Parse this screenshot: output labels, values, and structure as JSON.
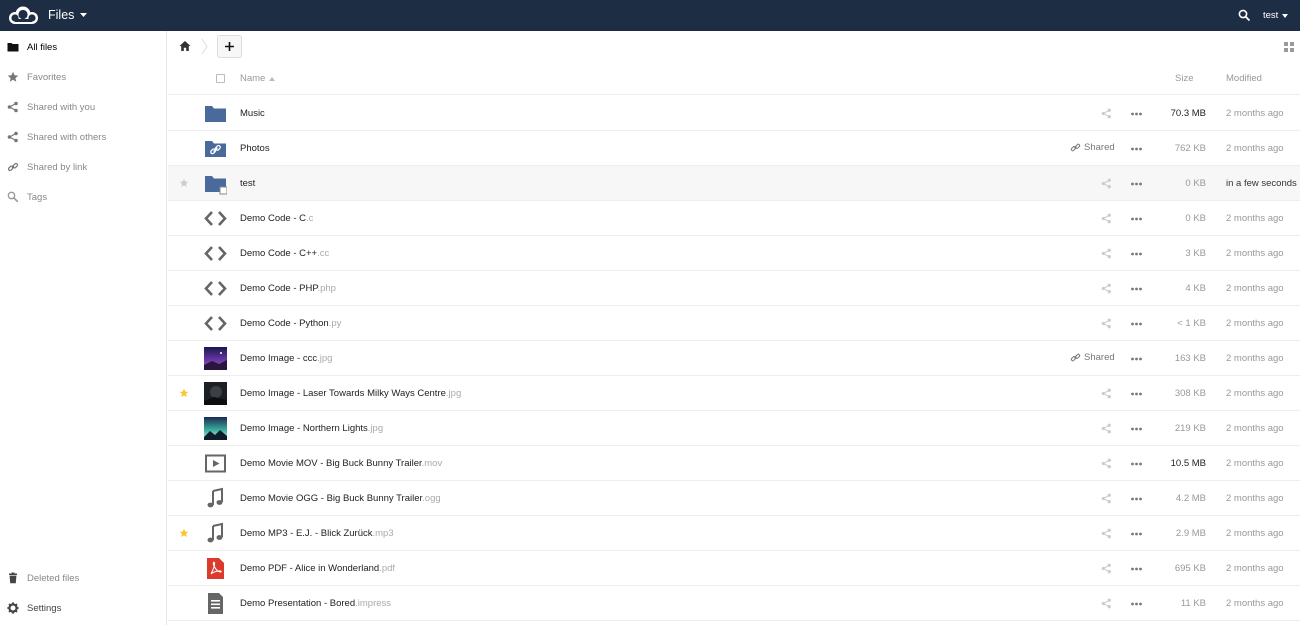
{
  "header": {
    "app_name": "Files",
    "user": "test"
  },
  "sidebar": {
    "items": [
      {
        "label": "All files",
        "icon": "folder-icon",
        "active": true
      },
      {
        "label": "Favorites",
        "icon": "star-icon",
        "active": false
      },
      {
        "label": "Shared with you",
        "icon": "share-icon",
        "active": false
      },
      {
        "label": "Shared with others",
        "icon": "share-icon",
        "active": false
      },
      {
        "label": "Shared by link",
        "icon": "link-icon",
        "active": false
      },
      {
        "label": "Tags",
        "icon": "tag-search-icon",
        "active": false
      }
    ],
    "footer": [
      {
        "label": "Deleted files",
        "icon": "trash-icon"
      },
      {
        "label": "Settings",
        "icon": "gear-icon"
      }
    ]
  },
  "table": {
    "headers": {
      "name": "Name",
      "size": "Size",
      "modified": "Modified"
    },
    "rows": [
      {
        "name": "Music",
        "ext": "",
        "type": "folder",
        "shared": "",
        "size": "70.3 MB",
        "size_big": true,
        "modified": "2 months ago",
        "favorite": false
      },
      {
        "name": "Photos",
        "ext": "",
        "type": "folder-link",
        "shared": "Shared",
        "size": "762 KB",
        "size_big": false,
        "modified": "2 months ago",
        "favorite": false
      },
      {
        "name": "test",
        "ext": "",
        "type": "folder-new",
        "shared": "",
        "size": "0 KB",
        "size_big": false,
        "modified": "in a few seconds",
        "favorite": false,
        "highlight": true
      },
      {
        "name": "Demo Code - C",
        "ext": ".c",
        "type": "code",
        "shared": "",
        "size": "0 KB",
        "size_big": false,
        "modified": "2 months ago",
        "favorite": false
      },
      {
        "name": "Demo Code - C++",
        "ext": ".cc",
        "type": "code",
        "shared": "",
        "size": "3 KB",
        "size_big": false,
        "modified": "2 months ago",
        "favorite": false
      },
      {
        "name": "Demo Code - PHP",
        "ext": ".php",
        "type": "code",
        "shared": "",
        "size": "4 KB",
        "size_big": false,
        "modified": "2 months ago",
        "favorite": false
      },
      {
        "name": "Demo Code - Python",
        "ext": ".py",
        "type": "code",
        "shared": "",
        "size": "< 1 KB",
        "size_big": false,
        "modified": "2 months ago",
        "favorite": false
      },
      {
        "name": "Demo Image - ccc",
        "ext": ".jpg",
        "type": "image-purple",
        "shared": "Shared",
        "size": "163 KB",
        "size_big": false,
        "modified": "2 months ago",
        "favorite": false
      },
      {
        "name": "Demo Image - Laser Towards Milky Ways Centre",
        "ext": ".jpg",
        "type": "image-dark",
        "shared": "",
        "size": "308 KB",
        "size_big": false,
        "modified": "2 months ago",
        "favorite": true
      },
      {
        "name": "Demo Image - Northern Lights",
        "ext": ".jpg",
        "type": "image-aurora",
        "shared": "",
        "size": "219 KB",
        "size_big": false,
        "modified": "2 months ago",
        "favorite": false
      },
      {
        "name": "Demo Movie MOV - Big Buck Bunny Trailer",
        "ext": ".mov",
        "type": "video",
        "shared": "",
        "size": "10.5 MB",
        "size_big": true,
        "modified": "2 months ago",
        "favorite": false
      },
      {
        "name": "Demo Movie OGG - Big Buck Bunny Trailer",
        "ext": ".ogg",
        "type": "audio",
        "shared": "",
        "size": "4.2 MB",
        "size_big": false,
        "modified": "2 months ago",
        "favorite": false
      },
      {
        "name": "Demo MP3 - E.J. - Blick Zurück",
        "ext": ".mp3",
        "type": "audio",
        "shared": "",
        "size": "2.9 MB",
        "size_big": false,
        "modified": "2 months ago",
        "favorite": true
      },
      {
        "name": "Demo PDF - Alice in Wonderland",
        "ext": ".pdf",
        "type": "pdf",
        "shared": "",
        "size": "695 KB",
        "size_big": false,
        "modified": "2 months ago",
        "favorite": false
      },
      {
        "name": "Demo Presentation - Bored",
        "ext": ".impress",
        "type": "document",
        "shared": "",
        "size": "11 KB",
        "size_big": false,
        "modified": "2 months ago",
        "favorite": false
      }
    ]
  },
  "colors": {
    "header_bg": "#1d2d44",
    "folder": "#4a6a9c",
    "favorite_star": "#fbc52d",
    "pdf": "#dc3a2c"
  }
}
